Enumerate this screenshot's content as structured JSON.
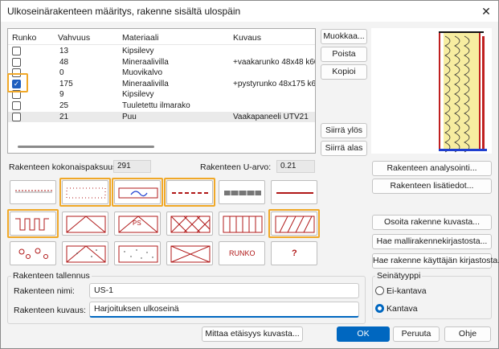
{
  "window": {
    "title": "Ulkoseinärakenteen määritys, rakenne sisältä ulospäin",
    "close_glyph": "✕"
  },
  "table": {
    "headers": [
      "Runko",
      "Vahvuus",
      "Materiaali",
      "Kuvaus"
    ],
    "rows": [
      {
        "checked": false,
        "thickness": "13",
        "material": "Kipsilevy",
        "description": ""
      },
      {
        "checked": false,
        "thickness": "48",
        "material": "Mineraalivilla",
        "description": "+vaakarunko 48x48 k600"
      },
      {
        "checked": false,
        "thickness": "0",
        "material": "Muovikalvo",
        "description": ""
      },
      {
        "checked": true,
        "thickness": "175",
        "material": "Mineraalivilla",
        "description": "+pystyrunko 48x175 k600"
      },
      {
        "checked": false,
        "thickness": "9",
        "material": "Kipsilevy",
        "description": ""
      },
      {
        "checked": false,
        "thickness": "25",
        "material": "Tuuletettu ilmarako",
        "description": ""
      },
      {
        "checked": false,
        "thickness": "21",
        "material": "Puu",
        "description": "Vaakapaneeli UTV21"
      }
    ]
  },
  "side_buttons": {
    "edit": "Muokkaa...",
    "delete": "Poista",
    "copy": "Kopioi",
    "move_up": "Siirrä ylös",
    "move_down": "Siirrä alas"
  },
  "totals": {
    "thickness_label": "Rakenteen kokonaispaksuus:",
    "thickness_value": "291",
    "u_label": "Rakenteen U-arvo:",
    "u_value": "0.21"
  },
  "right_buttons": {
    "analysis": "Rakenteen analysointi...",
    "details": "Rakenteen lisätiedot...",
    "show_from_image": "Osoita rakenne kuvasta...",
    "model_library": "Hae mallirakennekirjastosta...",
    "user_library": "Hae rakenne käyttäjän kirjastosta..."
  },
  "pattern_tiles": {
    "ps_label": "PS",
    "runko_label": "RUNKO",
    "unknown_label": "?"
  },
  "save_group": {
    "title": "Rakenteen tallennus",
    "name_label": "Rakenteen nimi:",
    "name_value": "US-1",
    "desc_label": "Rakenteen kuvaus:",
    "desc_value": "Harjoituksen ulkoseinä"
  },
  "wall_type": {
    "title": "Seinätyyppi",
    "option_non_bearing": "Ei-kantava",
    "option_bearing": "Kantava",
    "selected": "Kantava"
  },
  "footer": {
    "measure": "Mittaa etäisyys kuvasta...",
    "ok": "OK",
    "cancel": "Peruuta",
    "help": "Ohje"
  },
  "colors": {
    "accent": "#0067c0",
    "highlight": "#f0a828",
    "pattern": "#b01818"
  }
}
